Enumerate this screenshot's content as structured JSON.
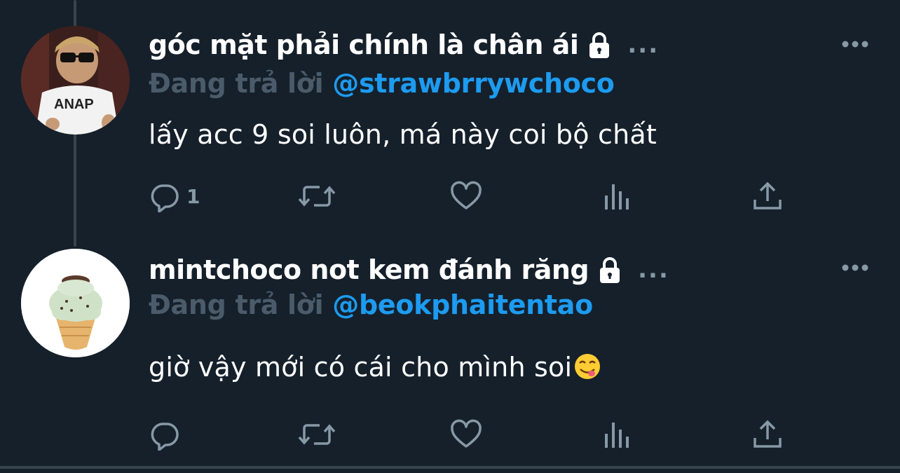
{
  "tweets": [
    {
      "display_name": "góc mặt phải chính là chân ái",
      "reply_prefix": "Đang trả lời",
      "reply_handle": "@strawbrrywchoco",
      "text": "lấy acc 9 soi luôn, má này coi bộ chất",
      "reply_count": "1",
      "dots": "..."
    },
    {
      "display_name": "mintchoco not kem đánh răng",
      "reply_prefix": "Đang trả lời",
      "reply_handle": "@beokphaitentao",
      "text": "giờ vậy mới có cái cho mình soi",
      "reply_count": "",
      "dots": "..."
    }
  ],
  "colors": {
    "background": "#15202b",
    "accent": "#1d9bf0",
    "muted": "#8899a6",
    "divider": "#38444d"
  },
  "icons": [
    "lock-icon",
    "more-icon",
    "reply-icon",
    "retweet-icon",
    "like-icon",
    "analytics-icon",
    "share-icon",
    "yum-face-emoji"
  ]
}
